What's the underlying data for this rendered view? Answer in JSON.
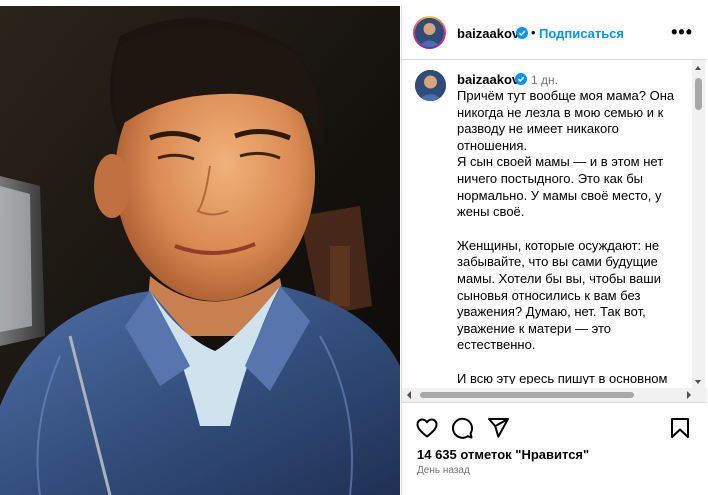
{
  "post": {
    "username": "baizaakov",
    "follow_label": "Подписаться",
    "separator": "•",
    "more_label": "•••",
    "caption_time": "1 дн.",
    "caption_paragraphs": [
      "Причём тут вообще моя мама? Она никогда не лезла в мою семью и к разводу не имеет никакого отношения.",
      "Я сын своей мамы — и в этом нет ничего постыдного. Это как бы нормально. У мамы своё место, у жены своё.",
      "Женщины, которые осуждают: не забывайте, что вы сами будущие мамы. Хотели бы вы, чтобы ваши сыновья относились к вам без уважения? Думаю, нет. Так вот, уважение к матери — это естественно.",
      "И всю эту ересь пишут в основном женщины. Вы уже совсем попутали"
    ],
    "likes_text": "14 635 отметок \"Нравится\"",
    "time_ago": "День назад"
  },
  "icons": {
    "verified": "verified-badge-icon",
    "like": "heart-icon",
    "comment": "comment-icon",
    "share": "share-icon",
    "save": "bookmark-icon"
  },
  "colors": {
    "accent": "#0095f6",
    "verified": "#0095f6",
    "muted": "#737373",
    "border": "#dbdbdb"
  }
}
